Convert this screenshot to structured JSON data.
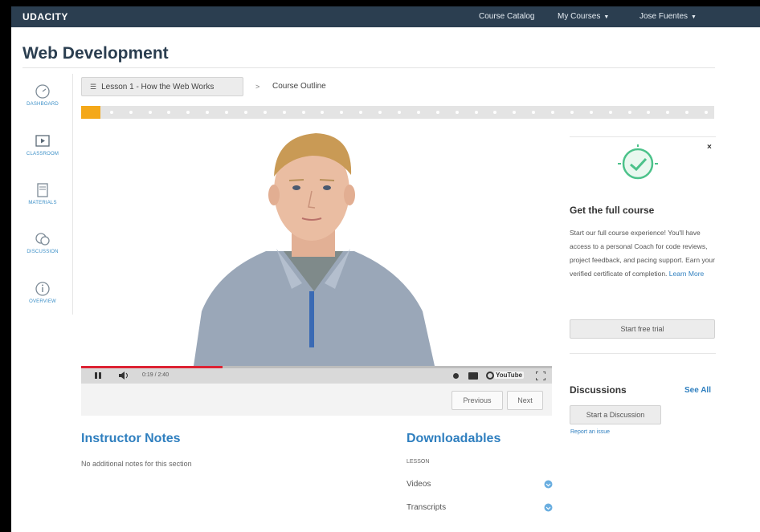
{
  "header": {
    "brand": "UDACITY",
    "links": [
      {
        "label": "Course Catalog"
      },
      {
        "label": "My Courses"
      },
      {
        "label": "Jose Fuentes"
      }
    ]
  },
  "page": {
    "title": "Web Development"
  },
  "sidebar": {
    "items": [
      {
        "label": "DASHBOARD",
        "icon": "dashboard-icon"
      },
      {
        "label": "CLASSROOM",
        "icon": "classroom-icon"
      },
      {
        "label": "MATERIALS",
        "icon": "materials-icon"
      },
      {
        "label": "DISCUSSION",
        "icon": "discussion-icon"
      },
      {
        "label": "OVERVIEW",
        "icon": "overview-icon"
      }
    ]
  },
  "breadcrumb": {
    "lesson": "Lesson 1 - How the Web Works",
    "separator": ">",
    "current": "Course Outline"
  },
  "progress": {
    "segments": 33,
    "current_index": 0
  },
  "video": {
    "time": "0:19 / 2:40",
    "youtube": "YouTube",
    "played_fraction": 0.3
  },
  "lesson_nav": {
    "previous": "Previous",
    "next": "Next"
  },
  "instructor_notes": {
    "title": "Instructor Notes",
    "text": "No additional notes for this section"
  },
  "downloadables": {
    "title": "Downloadables",
    "section_label": "LESSON",
    "items": [
      {
        "label": "Videos"
      },
      {
        "label": "Transcripts"
      }
    ]
  },
  "promo": {
    "title": "Get the full course",
    "text": "Start our full course experience! You'll have access to a personal Coach for code reviews, project feedback, and pacing support. Earn your verified certificate of completion.",
    "learn_more": "Learn More",
    "button": "Start free trial",
    "close": "×"
  },
  "discussions": {
    "title": "Discussions",
    "see_all": "See All",
    "button": "Start a Discussion",
    "report": "Report an issue"
  },
  "colors": {
    "nav_bg": "#2b3e50",
    "accent": "#2f7fbf",
    "progress_current": "#f4a819",
    "promo_green": "#4cc28a"
  }
}
